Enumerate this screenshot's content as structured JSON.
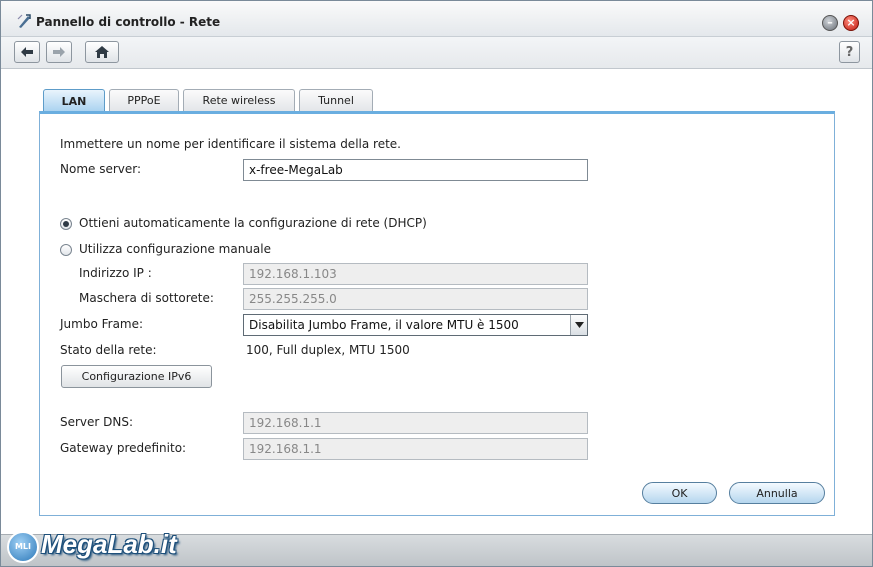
{
  "window": {
    "title": "Pannello di controllo - Rete",
    "help_label": "?"
  },
  "tabs": [
    {
      "label": "LAN",
      "active": true
    },
    {
      "label": "PPPoE",
      "active": false
    },
    {
      "label": "Rete wireless",
      "active": false
    },
    {
      "label": "Tunnel",
      "active": false
    }
  ],
  "form": {
    "intro": "Immettere un nome per identificare il sistema della rete.",
    "server_name_label": "Nome server:",
    "server_name_value": "x-free-MegaLab",
    "dhcp_label": "Ottieni automaticamente la configurazione di rete (DHCP)",
    "manual_label": "Utilizza configurazione manuale",
    "ip_label": "Indirizzo IP :",
    "ip_value": "192.168.1.103",
    "mask_label": "Maschera di sottorete:",
    "mask_value": "255.255.255.0",
    "jumbo_label": "Jumbo Frame:",
    "jumbo_value": "Disabilita Jumbo Frame, il valore MTU è 1500",
    "status_label": "Stato della rete:",
    "status_value": "100, Full duplex, MTU 1500",
    "ipv6_button": "Configurazione IPv6",
    "dns_label": "Server DNS:",
    "dns_value": "192.168.1.1",
    "gateway_label": "Gateway predefinito:",
    "gateway_value": "192.168.1.1",
    "ok_button": "OK",
    "cancel_button": "Annulla"
  },
  "watermark": {
    "badge": "MLI",
    "text": "MegaLab.it"
  },
  "colors": {
    "tab_active": "#a9d2f0",
    "panel_border": "#6aaee0",
    "close": "#c0170d"
  }
}
